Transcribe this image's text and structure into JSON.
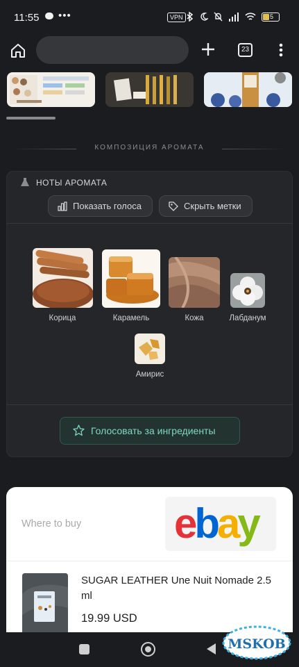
{
  "status_bar": {
    "time": "11:55",
    "more_indicator": "•••",
    "vpn_label": "VPN",
    "battery": "5",
    "icons": [
      "chat-bubble-icon",
      "bluetooth-icon",
      "moon-icon",
      "mute-icon",
      "signal-icon",
      "wifi-icon",
      "battery-icon"
    ]
  },
  "toolbar": {
    "tab_count": "23",
    "icons": [
      "home-icon",
      "plus-icon",
      "tabs-icon",
      "menu-dots-icon"
    ]
  },
  "section": {
    "title": "КОМПОЗИЦИЯ АРОМАТА"
  },
  "notes_card": {
    "heading": "НОТЫ АРОМАТА",
    "show_votes_label": "Показать голоса",
    "hide_tags_label": "Скрыть метки",
    "notes": [
      {
        "name": "Корица"
      },
      {
        "name": "Карамель"
      },
      {
        "name": "Кожа"
      },
      {
        "name": "Лабданум"
      },
      {
        "name": "Амирис"
      }
    ],
    "vote_button_label": "Голосовать за ингредиенты"
  },
  "where_to_buy": {
    "title": "Where to buy",
    "store_logo": "ebay",
    "logo_colors": [
      "#e53238",
      "#0064d2",
      "#f5af02",
      "#86b817"
    ],
    "product": {
      "name": "SUGAR LEATHER Une Nuit Nomade 2.5 ml",
      "price": "19.99 USD"
    }
  },
  "watermark": "MSKOB",
  "colors": {
    "background": "#1b1c1f",
    "card": "#25262a",
    "accent": "#7fd8c0"
  }
}
